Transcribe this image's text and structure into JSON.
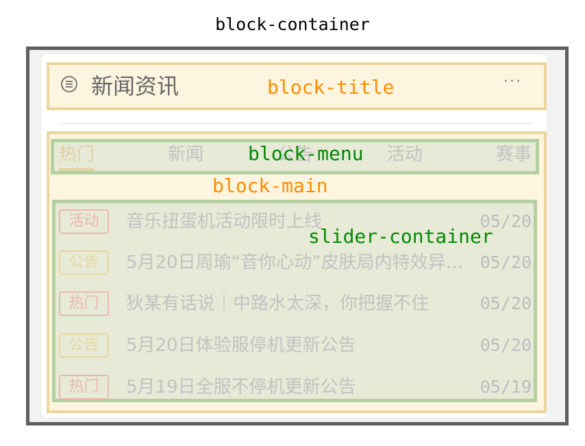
{
  "page_title": "block-container",
  "labels": {
    "title": "block-title",
    "menu": "block-menu",
    "main": "block-main",
    "slider": "slider-container"
  },
  "block_title": {
    "text": "新闻资讯",
    "icon": "list-circle-icon",
    "more_icon": "more-dots-icon",
    "more_text": "···"
  },
  "menu": {
    "items": [
      {
        "label": "热门",
        "active": true
      },
      {
        "label": "新闻",
        "active": false
      },
      {
        "label": "公告",
        "active": false
      },
      {
        "label": "活动",
        "active": false
      },
      {
        "label": "赛事",
        "active": false
      }
    ]
  },
  "news": [
    {
      "tag": "活动",
      "tag_type": "act",
      "title": "音乐扭蛋机活动限时上线",
      "date": "05/20"
    },
    {
      "tag": "公告",
      "tag_type": "notice",
      "title": "5月20日周瑜“音你心动”皮肤局内特效异…",
      "date": "05/20"
    },
    {
      "tag": "热门",
      "tag_type": "hot",
      "title": "狄某有话说｜中路水太深，你把握不住",
      "date": "05/20"
    },
    {
      "tag": "公告",
      "tag_type": "notice",
      "title": "5月20日体验服停机更新公告",
      "date": "05/20"
    },
    {
      "tag": "热门",
      "tag_type": "hot",
      "title": "5月19日全服不停机更新公告",
      "date": "05/19"
    }
  ],
  "colors": {
    "label_orange": "#ff8c00",
    "label_green": "#008a00",
    "outer_border": "#5f5f5f",
    "yellow_fill": "#fdf5df",
    "yellow_border": "#ead59a",
    "green_fill": "#e6ead7",
    "green_border": "#b4cfa0"
  }
}
